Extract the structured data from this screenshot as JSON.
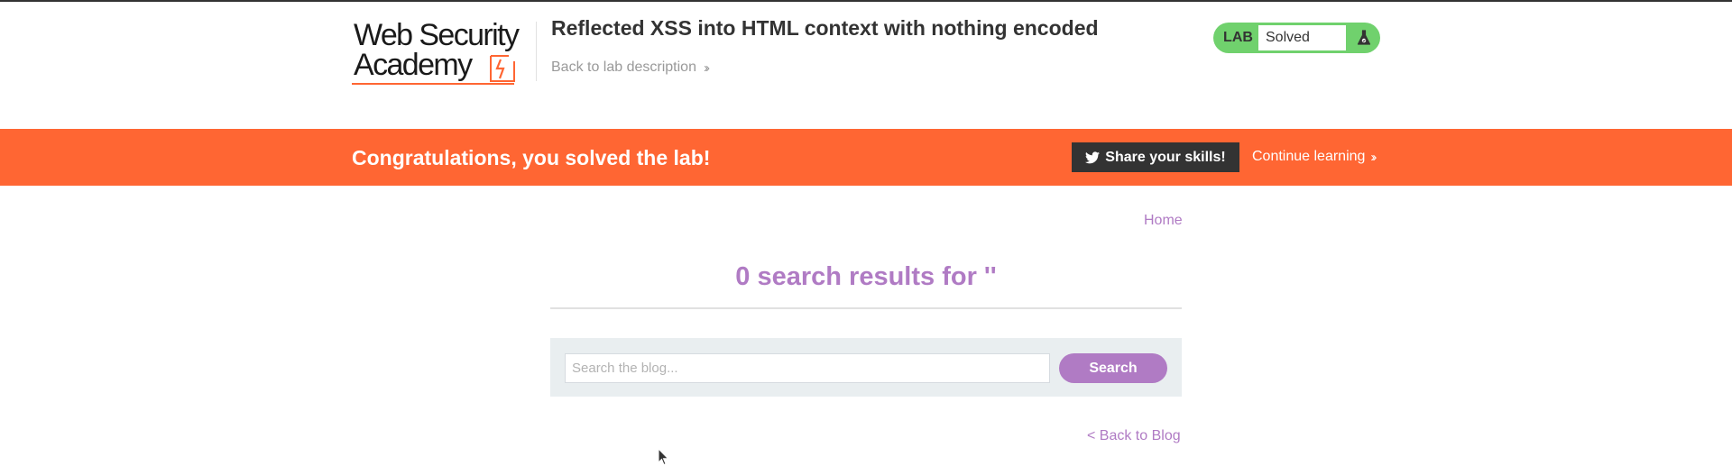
{
  "header": {
    "logo_line1": "Web Security",
    "logo_line2": "Academy",
    "lab_title": "Reflected XSS into HTML context with nothing encoded",
    "back_to_description": "Back to lab description",
    "status": {
      "badge": "LAB",
      "value": "Solved",
      "icon": "flask-icon",
      "color": "#70d16d"
    }
  },
  "banner": {
    "message": "Congratulations, you solved the lab!",
    "share_label": "Share your skills!",
    "share_icon": "twitter-bird-icon",
    "continue_label": "Continue learning",
    "color": "#ff6633"
  },
  "content": {
    "home_link": "Home",
    "results_heading": "0 search results for ''",
    "search": {
      "placeholder": "Search the blog...",
      "value": "",
      "button_label": "Search"
    },
    "back_to_blog": "< Back to Blog",
    "accent_color": "#b07bc4"
  }
}
